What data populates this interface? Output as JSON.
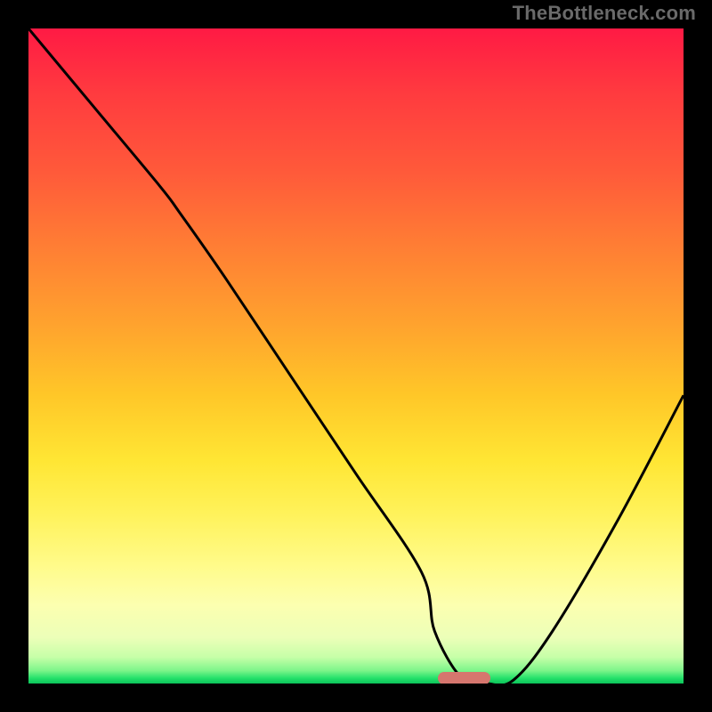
{
  "watermark": "TheBottleneck.com",
  "chart_data": {
    "type": "line",
    "title": "",
    "xlabel": "",
    "ylabel": "",
    "xlim": [
      0,
      100
    ],
    "ylim": [
      0,
      100
    ],
    "x": [
      0,
      10,
      20,
      23,
      30,
      40,
      50,
      60,
      62,
      66,
      70,
      74,
      80,
      90,
      100
    ],
    "y": [
      100,
      88,
      76,
      72,
      62,
      47,
      32,
      17,
      8,
      1,
      0,
      0.5,
      8,
      25,
      44
    ],
    "marker": {
      "x_start": 62.5,
      "x_end": 70.5,
      "y": 0.8
    },
    "gradient_stops": [
      {
        "pos": 0,
        "color": "#ff1a44"
      },
      {
        "pos": 10,
        "color": "#ff3b3f"
      },
      {
        "pos": 22,
        "color": "#ff5a3a"
      },
      {
        "pos": 33,
        "color": "#ff7d34"
      },
      {
        "pos": 45,
        "color": "#ffa22e"
      },
      {
        "pos": 56,
        "color": "#ffc728"
      },
      {
        "pos": 66,
        "color": "#ffe634"
      },
      {
        "pos": 74,
        "color": "#fff25a"
      },
      {
        "pos": 82,
        "color": "#fffb8a"
      },
      {
        "pos": 88,
        "color": "#fcffb0"
      },
      {
        "pos": 93,
        "color": "#ecffb8"
      },
      {
        "pos": 96,
        "color": "#c6ffa8"
      },
      {
        "pos": 98,
        "color": "#7ef58a"
      },
      {
        "pos": 99.2,
        "color": "#23e06a"
      },
      {
        "pos": 100,
        "color": "#0cc45a"
      }
    ]
  }
}
